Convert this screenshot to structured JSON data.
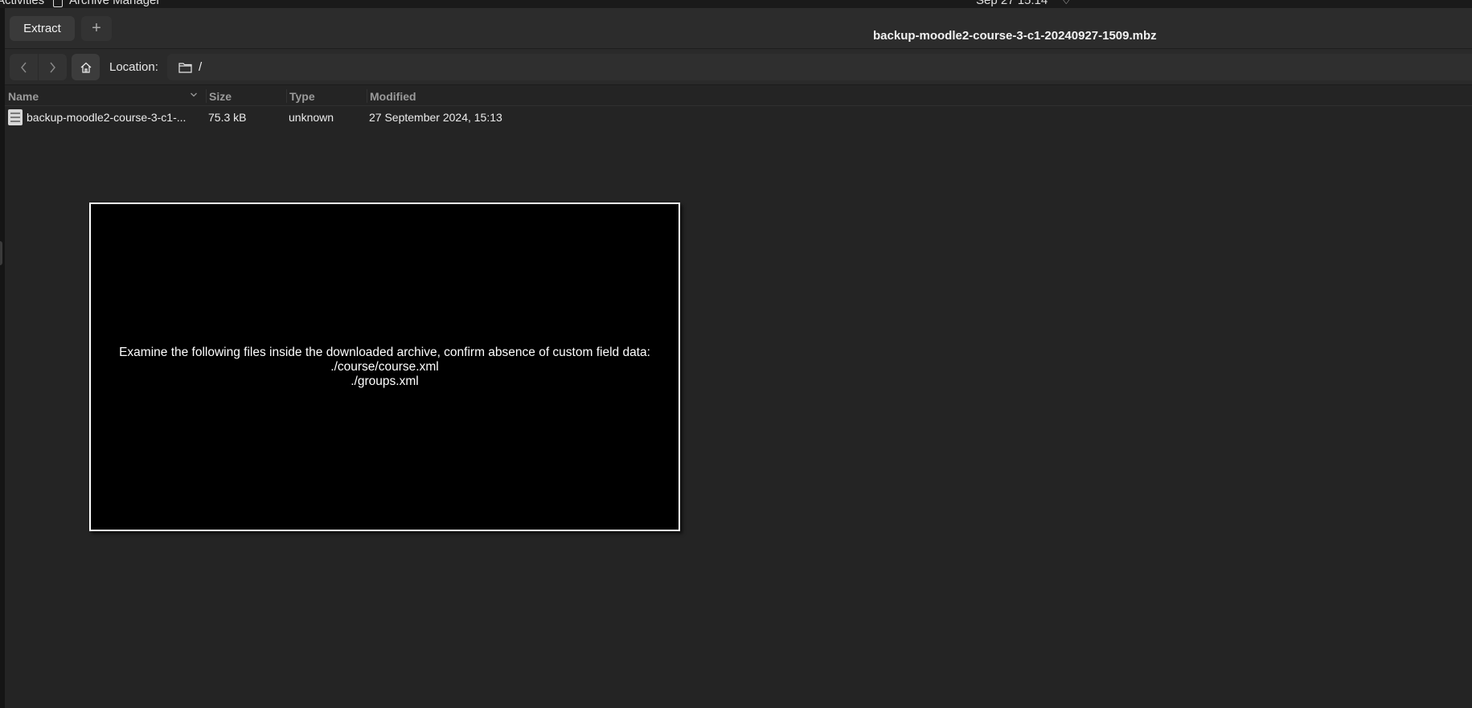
{
  "topbar": {
    "activities": "Activities",
    "app_name": "Archive Manager",
    "clock": "Sep 27  15:14"
  },
  "header": {
    "extract_label": "Extract",
    "add_label": "+",
    "title": "backup-moodle2-course-3-c1-20240927-1509.mbz"
  },
  "toolbar": {
    "back_icon": "chevron-left-icon",
    "forward_icon": "chevron-right-icon",
    "home_icon": "home-icon",
    "location_label": "Location:",
    "location_value": "/"
  },
  "columns": {
    "name": "Name",
    "size": "Size",
    "type": "Type",
    "modified": "Modified"
  },
  "files": [
    {
      "name": "backup-moodle2-course-3-c1-...",
      "size": "75.3 kB",
      "type": "unknown",
      "modified": "27 September 2024, 15:13"
    }
  ],
  "overlay": {
    "line1": "Examine the following files inside the downloaded archive, confirm absence of custom field data:",
    "line2": "./course/course.xml",
    "line3": "./groups.xml"
  }
}
